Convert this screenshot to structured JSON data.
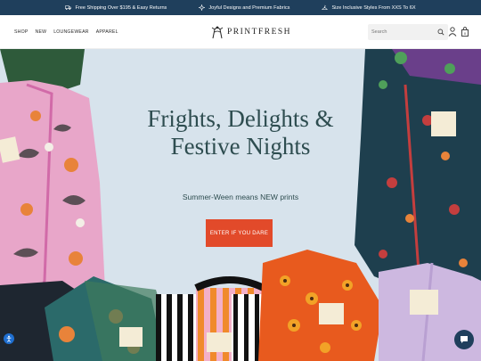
{
  "announcement": {
    "items": [
      {
        "icon": "truck-icon",
        "text": "Free Shipping Over $195 & Easy Returns"
      },
      {
        "icon": "sparkle-icon",
        "text": "Joyful Designs and Premium Fabrics"
      },
      {
        "icon": "hanger-icon",
        "text": "Size Inclusive Styles From XXS To 6X"
      }
    ]
  },
  "nav": {
    "items": [
      "SHOP",
      "NEW",
      "LOUNGEWEAR",
      "APPAREL"
    ]
  },
  "logo": {
    "text": "PRINTFRESH"
  },
  "search": {
    "placeholder": "Search"
  },
  "hero": {
    "headline_line1": "Frights, Delights &",
    "headline_line2": "Festive Nights",
    "subheadline": "Summer-Ween means NEW prints",
    "cta_label": "ENTER IF YOU DARE"
  },
  "colors": {
    "announcement_bg": "#1f3f5c",
    "hero_bg": "#d7e3ec",
    "cta": "#e24a2a",
    "headline": "#2e4d50"
  }
}
